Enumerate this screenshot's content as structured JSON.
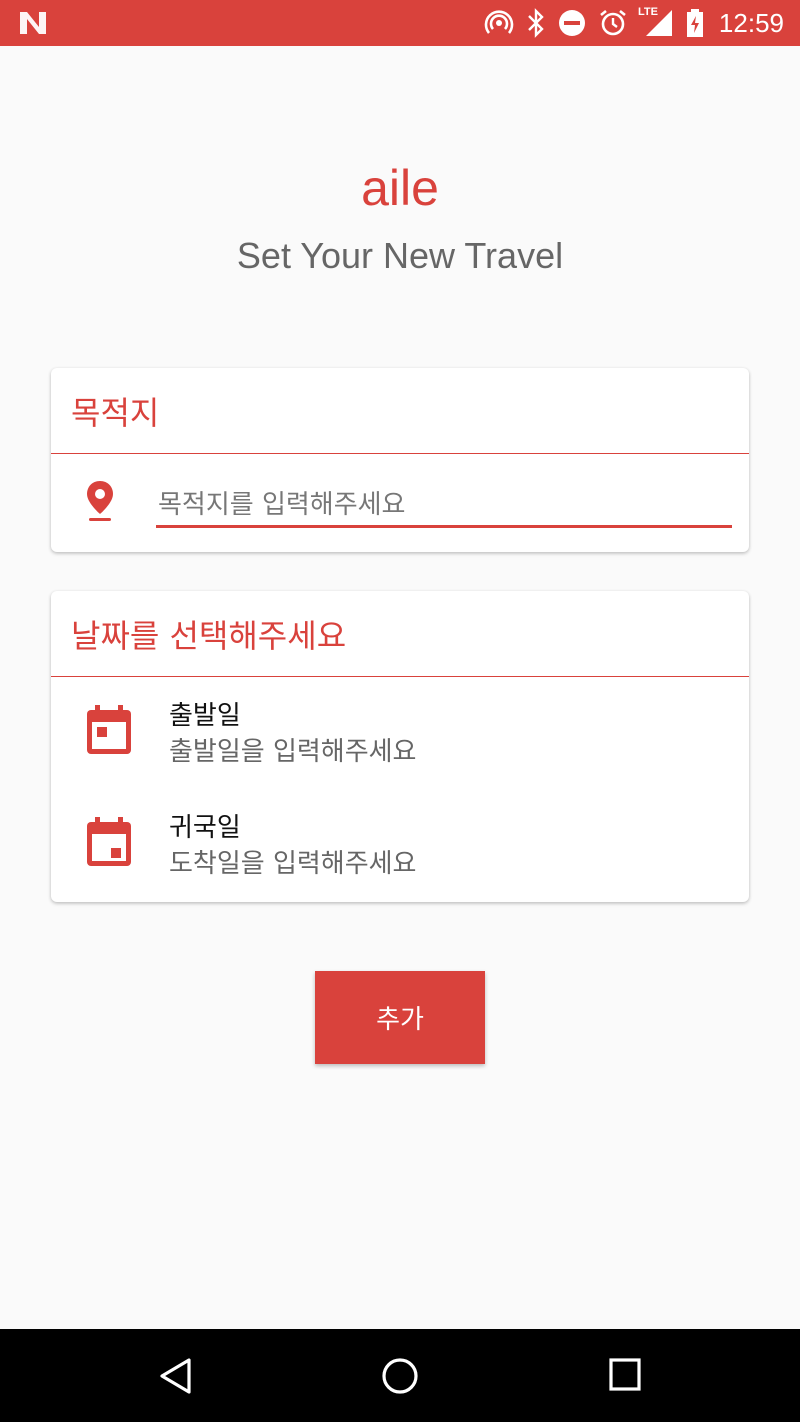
{
  "status_bar": {
    "time": "12:59",
    "network_label": "LTE",
    "icons": [
      "n-logo-icon",
      "hotspot-icon",
      "bluetooth-icon",
      "dnd-icon",
      "alarm-icon",
      "signal-icon",
      "battery-charging-icon"
    ]
  },
  "header": {
    "title": "aile",
    "subtitle": "Set Your New Travel"
  },
  "destination_card": {
    "title": "목적지",
    "input_placeholder": "목적지를 입력해주세요",
    "input_value": ""
  },
  "date_card": {
    "title": "날짜를 선택해주세요",
    "departure": {
      "label": "출발일",
      "hint": "출발일을 입력해주세요"
    },
    "return": {
      "label": "귀국일",
      "hint": "도착일을 입력해주세요"
    }
  },
  "actions": {
    "add_label": "추가"
  },
  "nav_bar": {
    "icons": [
      "back-icon",
      "home-icon",
      "recents-icon"
    ]
  },
  "colors": {
    "accent": "#d9423c",
    "background": "#fafafa",
    "nav_bar": "#000000"
  }
}
